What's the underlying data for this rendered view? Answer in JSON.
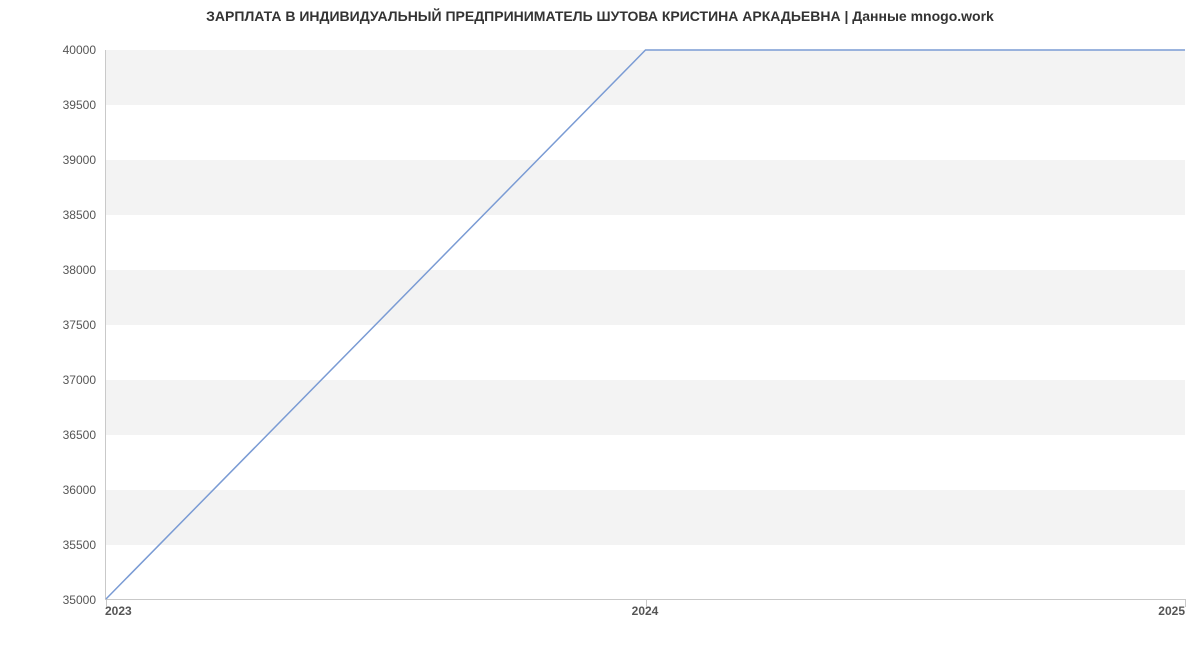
{
  "chart_data": {
    "type": "line",
    "title": "ЗАРПЛАТА В ИНДИВИДУАЛЬНЫЙ ПРЕДПРИНИМАТЕЛЬ ШУТОВА КРИСТИНА АРКАДЬЕВНА | Данные mnogo.work",
    "xlabel": "",
    "ylabel": "",
    "x": [
      2023,
      2024,
      2025
    ],
    "values": [
      35000,
      40000,
      40000
    ],
    "x_ticks": [
      2023,
      2024,
      2025
    ],
    "y_ticks": [
      35000,
      35500,
      36000,
      36500,
      37000,
      37500,
      38000,
      38500,
      39000,
      39500,
      40000
    ],
    "ylim": [
      35000,
      40000
    ],
    "xlim": [
      2023,
      2025
    ],
    "line_color": "#7a9bd4",
    "band_color": "#f3f3f3"
  }
}
